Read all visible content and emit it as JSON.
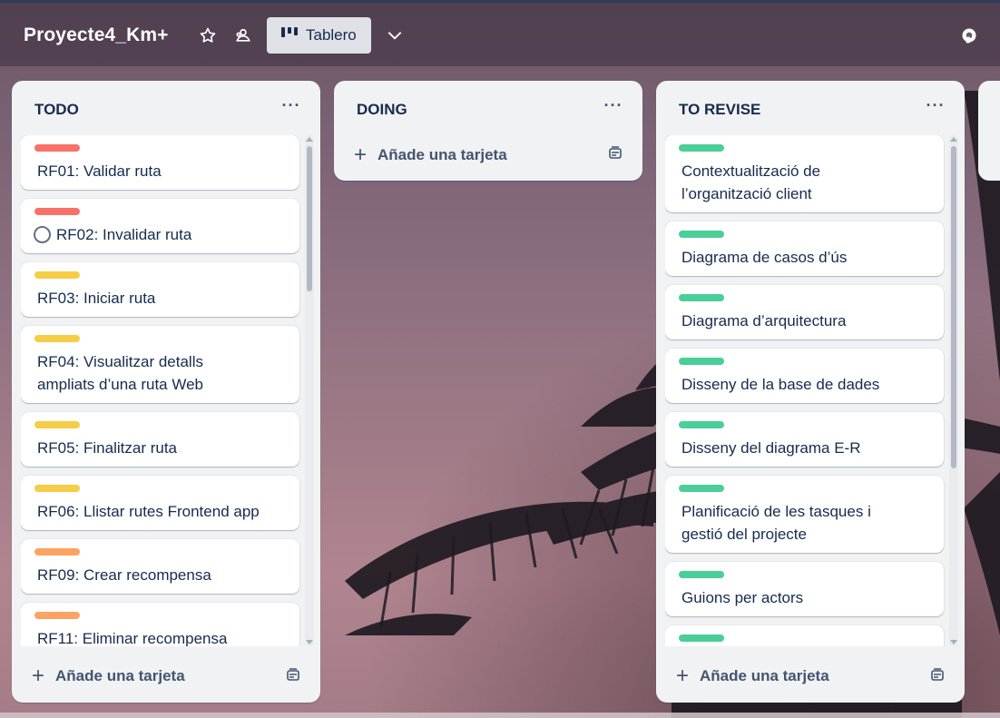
{
  "header": {
    "board_title": "Proyecte4_Km+",
    "view_label": "Tablero"
  },
  "colors": {
    "red": "#f87168",
    "yellow": "#f5cd47",
    "orange": "#fea362",
    "green": "#4bce97"
  },
  "lists": [
    {
      "title": "TODO",
      "add_label": "Añade una tarjeta",
      "cards": [
        {
          "label_color": "red",
          "text": "RF01: Validar ruta"
        },
        {
          "label_color": "red",
          "text": "RF02: Invalidar ruta",
          "has_circle": true
        },
        {
          "label_color": "yellow",
          "text": "RF03: Iniciar ruta"
        },
        {
          "label_color": "yellow",
          "text": "RF04: Visualitzar detalls ampliats d’una ruta Web"
        },
        {
          "label_color": "yellow",
          "text": "RF05: Finalitzar ruta"
        },
        {
          "label_color": "yellow",
          "text": "RF06: Llistar rutes Frontend app"
        },
        {
          "label_color": "orange",
          "text": "RF09: Crear recompensa"
        },
        {
          "label_color": "orange",
          "text": "RF11: Eliminar recompensa"
        }
      ]
    },
    {
      "title": "DOING",
      "add_label": "Añade una tarjeta",
      "cards": []
    },
    {
      "title": "TO REVISE",
      "add_label": "Añade una tarjeta",
      "cards": [
        {
          "label_color": "green",
          "text": "Contextualització de l’organització client"
        },
        {
          "label_color": "green",
          "text": "Diagrama de casos d’ús"
        },
        {
          "label_color": "green",
          "text": "Diagrama d’arquitectura"
        },
        {
          "label_color": "green",
          "text": "Disseny de la base de dades"
        },
        {
          "label_color": "green",
          "text": "Disseny del diagrama E-R"
        },
        {
          "label_color": "green",
          "text": "Planificació de les tasques i gestió del projecte"
        },
        {
          "label_color": "green",
          "text": "Guions per actors"
        },
        {
          "label_color": "green",
          "text": ""
        }
      ]
    }
  ],
  "icons": {
    "star": "star-icon",
    "visibility": "workspace-visibility-icon",
    "board_view": "board-view-icon",
    "view_switch": "chevron-down-icon",
    "powerup": "power-up-icon",
    "list_menu": "more-horizontal-icon",
    "template": "card-template-icon",
    "add": "plus-icon"
  }
}
